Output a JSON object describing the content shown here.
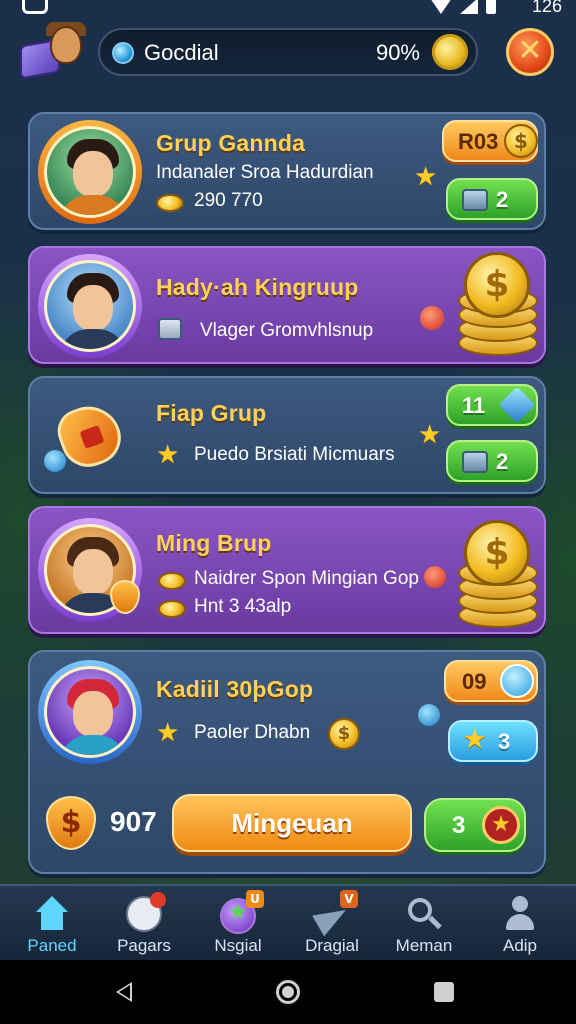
{
  "status_bar": {
    "time": "126"
  },
  "header": {
    "search_label": "Gocdial",
    "percent": "90%",
    "close_symbol": "✕"
  },
  "groups": [
    {
      "title": "Grup Gannda",
      "subtitle": "Indanaler Sroa Hadurdian",
      "coins": "290 770",
      "pill_top": "R03",
      "pill_bottom": "2"
    },
    {
      "title": "Hady·ah Kingruup",
      "subtitle": "Vlager Gromvhlsnup"
    },
    {
      "title": "Fiap Grup",
      "subtitle": "Puedo Brsiati Micmuars",
      "pill_top": "11",
      "pill_bottom": "2"
    },
    {
      "title": "Ming Brup",
      "subtitle": "Naidrer Spon Mingian Gop",
      "subtitle2": "Hnt 3 43alp"
    },
    {
      "title": "Kadiil 30þGop",
      "subtitle": "Paoler Dhabn",
      "pill_top": "09",
      "pill_bottom": "3",
      "score": "907",
      "action_label": "Mingeuan",
      "green_count": "3"
    }
  ],
  "icons": {
    "dollar": "$",
    "star": "★"
  },
  "bottom_nav": [
    {
      "label": "Paned"
    },
    {
      "label": "Pagars"
    },
    {
      "label": "Nsgial"
    },
    {
      "label": "Dragial"
    },
    {
      "label": "Meman"
    },
    {
      "label": "Adip"
    }
  ],
  "badges": {
    "nsgial": "U",
    "dragial": "V"
  }
}
